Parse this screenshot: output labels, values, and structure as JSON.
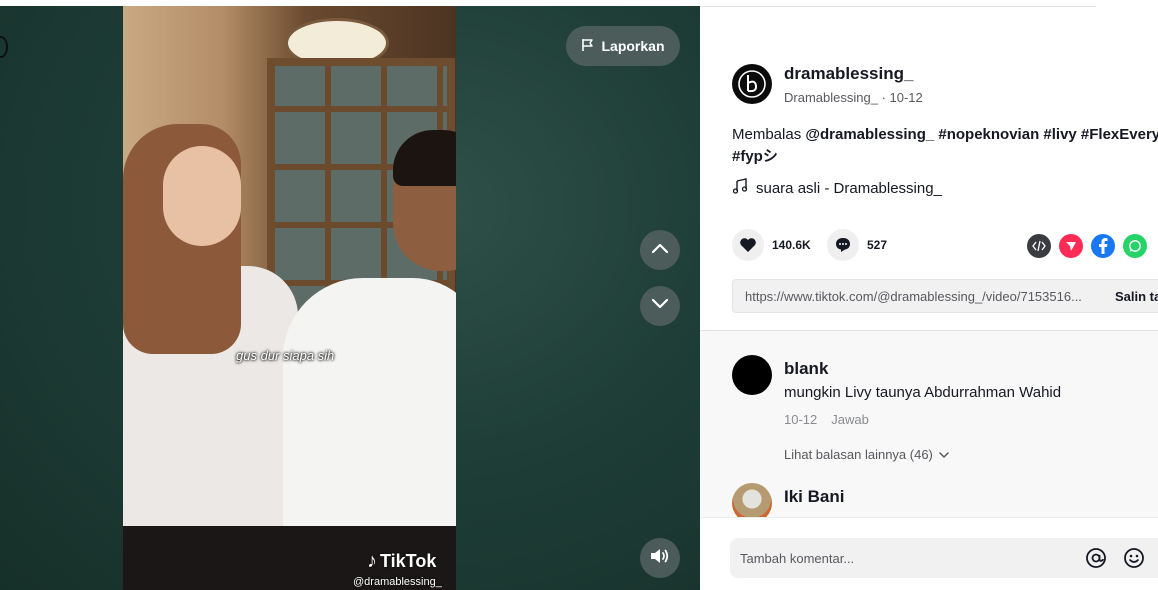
{
  "video": {
    "report_label": "Laporkan",
    "caption": "gus dur siapa sih",
    "watermark_brand": "TikTok",
    "watermark_handle": "@dramablessing_",
    "icons": {
      "report": "flag-icon",
      "prev": "chevron-up-icon",
      "next": "chevron-down-icon",
      "sound": "speaker-icon"
    }
  },
  "post": {
    "author_username": "dramablessing_",
    "author_nickname": "Dramablessing_",
    "date": "10-12",
    "description": {
      "prefix": "Membalas ",
      "mention": "@dramablessing_",
      "hashtags_line1": " #nopeknovian #livy #FlexEvery",
      "hashtags_line2": "#fypシ"
    },
    "music": "suara asli - Dramablessing_",
    "likes": "140.6K",
    "comments": "527",
    "url": "https://www.tiktok.com/@dramablessing_/video/7153516...",
    "copy_label": "Salin ta",
    "share_icons": [
      "embed-icon",
      "send-icon",
      "facebook-icon",
      "whatsapp-icon"
    ],
    "colors": {
      "embed": "#3b3b42",
      "send": "#fe2c55",
      "facebook": "#1877f2",
      "whatsapp": "#25d366"
    }
  },
  "comments": [
    {
      "name": "blank",
      "text": "mungkin Livy taunya Abdurrahman Wahid",
      "date": "10-12",
      "reply_label": "Jawab",
      "more_replies": "Lihat balasan lainnya (46)"
    },
    {
      "name": "Iki Bani"
    }
  ],
  "comment_input": {
    "placeholder": "Tambah komentar..."
  }
}
